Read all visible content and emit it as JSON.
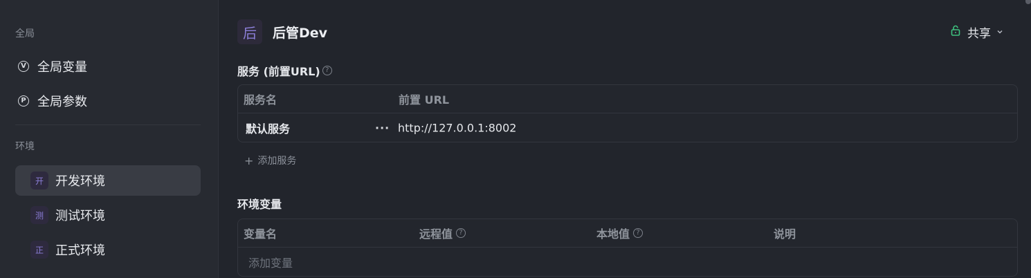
{
  "sidebar": {
    "global_title": "全局",
    "global_items": [
      {
        "icon": "v-circle-icon",
        "glyph": "V",
        "label": "全局变量"
      },
      {
        "icon": "p-circle-icon",
        "glyph": "P",
        "label": "全局参数"
      }
    ],
    "env_title": "环境",
    "env_items": [
      {
        "badge": "开",
        "label": "开发环境",
        "active": true
      },
      {
        "badge": "测",
        "label": "测试环境",
        "active": false
      },
      {
        "badge": "正",
        "label": "正式环境",
        "active": false
      }
    ]
  },
  "header": {
    "badge": "后",
    "title": "后管Dev",
    "share_label": "共享",
    "share_icon": "unlock-icon"
  },
  "services": {
    "title": "服务 (前置URL)",
    "help": "?",
    "columns": [
      "服务名",
      "前置 URL"
    ],
    "rows": [
      {
        "name": "默认服务",
        "more": "···",
        "url": "http://127.0.0.1:8002"
      }
    ],
    "add_label": "添加服务"
  },
  "variables": {
    "title": "环境变量",
    "columns": [
      "变量名",
      "远程值",
      "本地值",
      "说明"
    ],
    "placeholder": "添加变量"
  },
  "colors": {
    "accent": "#8c7fd8",
    "lock": "#3ec27f",
    "background": "#22252c"
  }
}
